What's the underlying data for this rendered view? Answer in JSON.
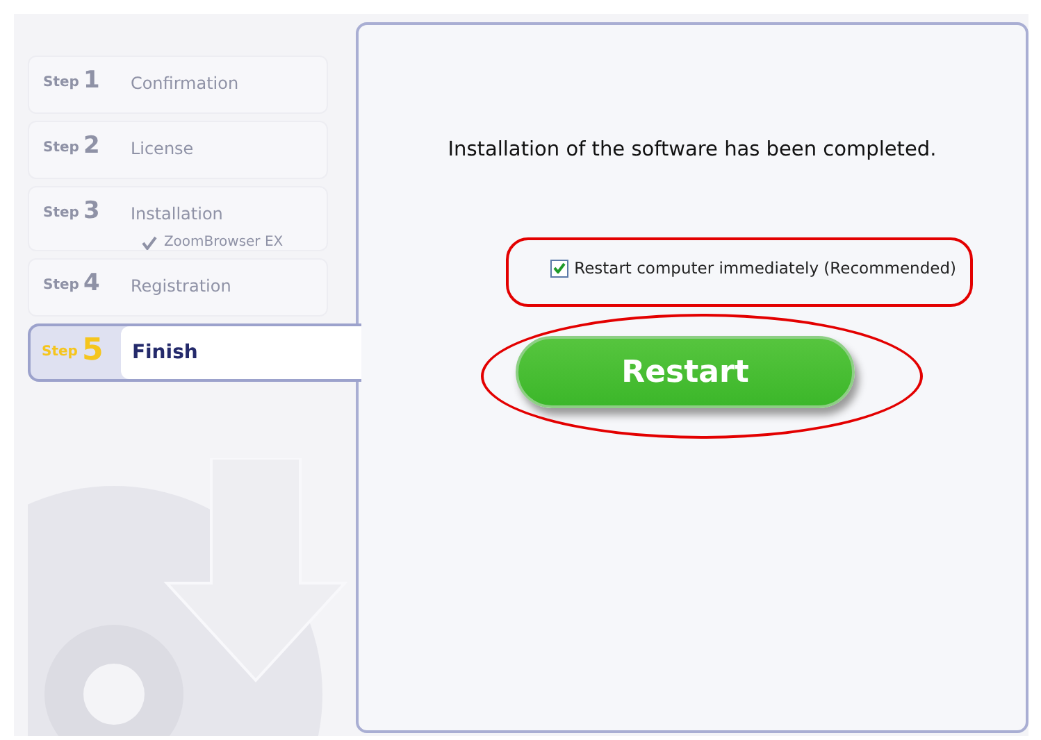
{
  "steps": [
    {
      "step_word": "Step",
      "number": "1",
      "label": "Confirmation",
      "selected": false
    },
    {
      "step_word": "Step",
      "number": "2",
      "label": "License",
      "selected": false
    },
    {
      "step_word": "Step",
      "number": "3",
      "label": "Installation",
      "selected": false,
      "children": [
        {
          "label": "ZoomBrowser EX",
          "checked": true
        }
      ]
    },
    {
      "step_word": "Step",
      "number": "4",
      "label": "Registration",
      "selected": false
    },
    {
      "step_word": "Step",
      "number": "5",
      "label": "Finish",
      "selected": true
    }
  ],
  "panel": {
    "message": "Installation of the software has been completed.",
    "checkbox": {
      "label": "Restart computer immediately (Recommended)",
      "checked": true
    },
    "button": "Restart"
  }
}
